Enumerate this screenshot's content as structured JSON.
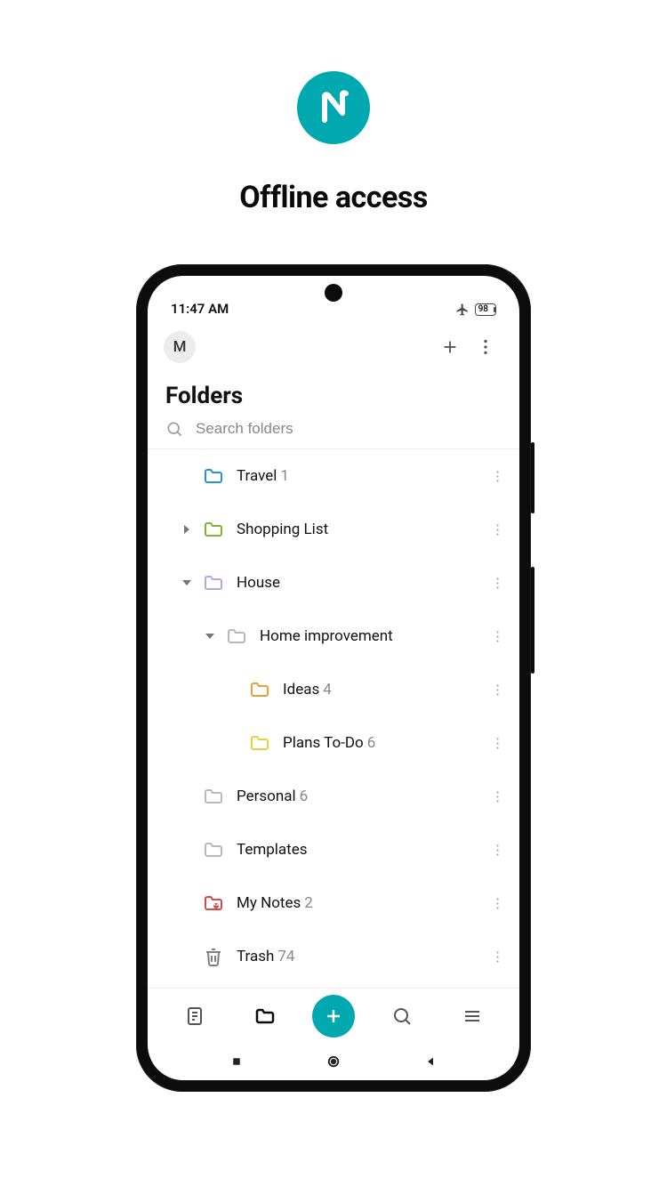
{
  "promo": {
    "title": "Offline access",
    "logo_letter": "N"
  },
  "status_bar": {
    "time": "11:47 AM",
    "battery": "98"
  },
  "header": {
    "avatar_initial": "M"
  },
  "page": {
    "title": "Folders"
  },
  "search": {
    "placeholder": "Search folders"
  },
  "folders": [
    {
      "name": "Travel",
      "count": "1",
      "color": "#2a8fd8",
      "indent": 1,
      "chevron": "none"
    },
    {
      "name": "Shopping List",
      "count": "",
      "color": "#7bb62f",
      "indent": 1,
      "chevron": "right"
    },
    {
      "name": "House",
      "count": "",
      "color": "#b9a3e3",
      "indent": 1,
      "chevron": "down"
    },
    {
      "name": "Home improvement",
      "count": "",
      "color": "#b8b8b8",
      "indent": 2,
      "chevron": "down"
    },
    {
      "name": "Ideas",
      "count": "4",
      "color": "#e8a13a",
      "indent": 3,
      "chevron": "none"
    },
    {
      "name": "Plans To-Do",
      "count": "6",
      "color": "#e9cf3e",
      "indent": 3,
      "chevron": "none"
    },
    {
      "name": "Personal",
      "count": "6",
      "color": "#b8b8b8",
      "indent": 1,
      "chevron": "none"
    },
    {
      "name": "Templates",
      "count": "",
      "color": "#b8b8b8",
      "indent": 1,
      "chevron": "none"
    },
    {
      "name": "My Notes",
      "count": "2",
      "color": "#d34a4a",
      "indent": 1,
      "chevron": "none",
      "icon": "shared"
    },
    {
      "name": "Trash",
      "count": "74",
      "color": "#808080",
      "indent": 1,
      "chevron": "none",
      "icon": "trash"
    }
  ],
  "colors": {
    "accent": "#00a9b0"
  }
}
